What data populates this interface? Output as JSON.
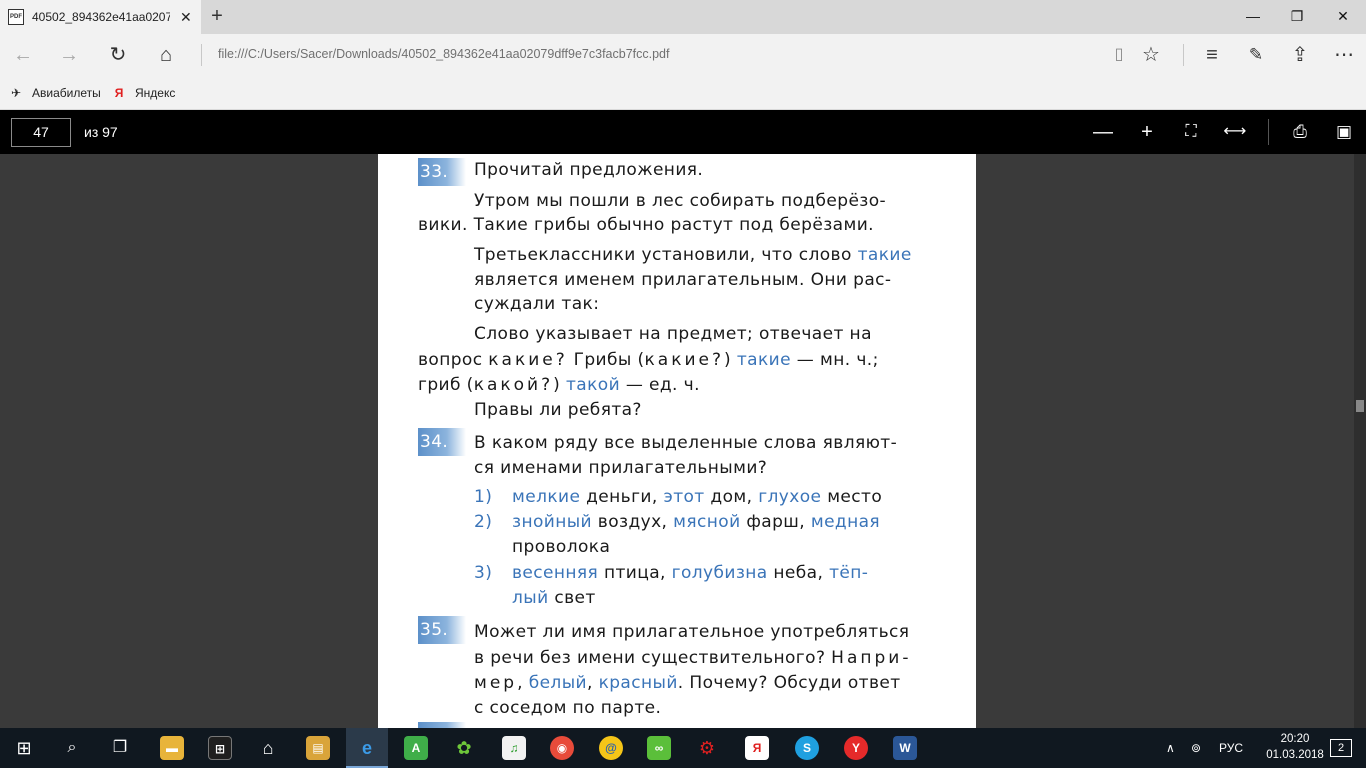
{
  "browser": {
    "tab_title": "40502_894362e41aa02079dff9e7c3facb7fcc.pdf",
    "tab_close": "✕",
    "new_tab": "+",
    "window_controls": {
      "minimize": "—",
      "maximize": "❐",
      "close": "✕"
    },
    "url": "file:///C:/Users/Sacer/Downloads/40502_894362e41aa02079dff9e7c3facb7fcc.pdf"
  },
  "favorites": [
    {
      "label": "Авиабилеты",
      "icon": "plane-icon"
    },
    {
      "label": "Яндекс",
      "icon": "yandex-icon"
    }
  ],
  "pdf_toolbar": {
    "current_page": "47",
    "total_pages": "из 97"
  },
  "page": {
    "ex33": {
      "number": "33.",
      "title": "Прочитай предложения.",
      "s1a": "Утром мы пошли в лес собирать подберёзо-",
      "s1b": "вики. Такие грибы обычно растут под берёзами.",
      "p2a_pre": "Третьеклассники установили, что слово ",
      "p2a_word": "такие",
      "p2b": "является именем прилагательным. Они рас-",
      "p2c": "суждали так:",
      "p3a": "Слово указывает на предмет; отвечает на",
      "p3b_1": "вопрос ",
      "p3b_q": "какие?",
      "p3b_2": " Грибы (",
      "p3b_q2": "какие?",
      "p3b_3": ") ",
      "p3b_word": "такие",
      "p3b_4": " — мн. ч.;",
      "p3c_1": "гриб (",
      "p3c_q": "какой?",
      "p3c_2": ") ",
      "p3c_word": "такой",
      "p3c_3": " — ед. ч.",
      "question": "Правы ли ребята?"
    },
    "ex34": {
      "number": "34.",
      "title_a": "В каком ряду все выделенные слова являют-",
      "title_b": "ся именами прилагательными?",
      "o1_num": "1)",
      "o1_w1": "мелкие",
      "o1_t1": " деньги, ",
      "o1_w2": "этот",
      "o1_t2": " дом, ",
      "o1_w3": "глухое",
      "o1_t3": " место",
      "o2_num": "2)",
      "o2_w1": "знойный",
      "o2_t1": " воздух, ",
      "o2_w2": "мясной",
      "o2_t2": " фарш, ",
      "o2_w3": "медная",
      "o2_t3": "проволока",
      "o3_num": "3)",
      "o3_w1": "весенняя",
      "o3_t1": " птица, ",
      "o3_w2": "голубизна",
      "o3_t2": " неба, ",
      "o3_w3a": "тёп-",
      "o3_w3b": "лый",
      "o3_t3": " свет"
    },
    "ex35": {
      "number": "35.",
      "l1": "Может ли имя прилагательное употребляться",
      "l2_1": "в речи без имени существительного? ",
      "l2_sp": "Напри-",
      "l3_sp": "мер",
      "l3_1": ", ",
      "l3_w1": "белый",
      "l3_2": ", ",
      "l3_w2": "красный",
      "l3_3": ". Почему? Обсуди ответ",
      "l4": "с соседом по парте."
    }
  },
  "taskbar": {
    "language": "РУС",
    "time": "20:20",
    "date": "01.03.2018",
    "notifications": "2"
  }
}
